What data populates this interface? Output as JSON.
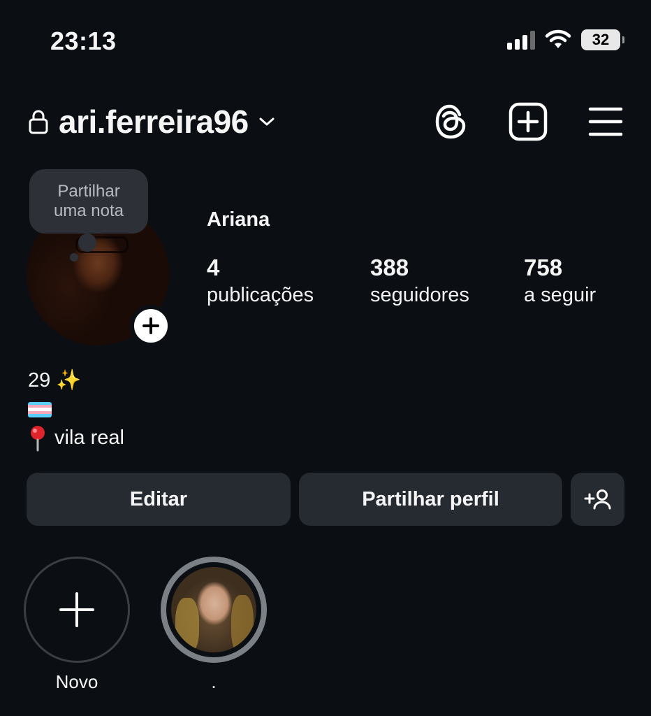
{
  "status_bar": {
    "time": "23:13",
    "battery": "32"
  },
  "header": {
    "username": "ari.ferreira96"
  },
  "profile": {
    "note_bubble": "Partilhar uma nota",
    "display_name": "Ariana",
    "stats": [
      {
        "value": "4",
        "label": "publicações"
      },
      {
        "value": "388",
        "label": "seguidores"
      },
      {
        "value": "758",
        "label": "a seguir"
      }
    ],
    "bio": {
      "line1": "29 ✨",
      "line3": "vila real"
    }
  },
  "actions": {
    "edit_label": "Editar",
    "share_label": "Partilhar perfil"
  },
  "highlights": [
    {
      "label": "Novo"
    },
    {
      "label": "."
    }
  ],
  "colors": {
    "background": "#0b0f14",
    "button_bg": "#262a31",
    "trans_flag": [
      "#5bcefa",
      "#f5a9b8",
      "#ffffff",
      "#f5a9b8",
      "#5bcefa"
    ]
  }
}
